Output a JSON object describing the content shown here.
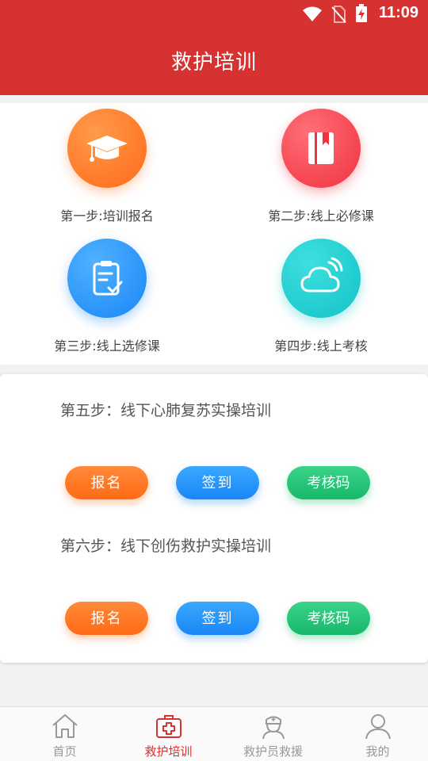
{
  "status_bar": {
    "time": "11:09"
  },
  "header": {
    "title": "救护培训"
  },
  "steps": [
    {
      "label": "第一步:培训报名",
      "icon": "graduation-cap-icon"
    },
    {
      "label": "第二步:线上必修课",
      "icon": "book-icon"
    },
    {
      "label": "第三步:线上选修课",
      "icon": "clipboard-check-icon"
    },
    {
      "label": "第四步:线上考核",
      "icon": "cloud-icon"
    }
  ],
  "offline": [
    {
      "title": "第五步：线下心肺复苏实操培训",
      "buttons": {
        "register": "报名",
        "checkin": "签到",
        "exam_code": "考核码"
      }
    },
    {
      "title": "第六步：线下创伤救护实操培训",
      "buttons": {
        "register": "报名",
        "checkin": "签到",
        "exam_code": "考核码"
      }
    }
  ],
  "nav": [
    {
      "label": "首页",
      "icon": "home-icon"
    },
    {
      "label": "救护培训",
      "icon": "medical-kit-icon",
      "active": true
    },
    {
      "label": "救护员救援",
      "icon": "nurse-icon"
    },
    {
      "label": "我的",
      "icon": "user-icon"
    }
  ],
  "colors": {
    "brand_red": "#d63232",
    "orange": "#ff6a1a",
    "red": "#f0323f",
    "blue": "#1a86f5",
    "teal": "#12c2c8",
    "green": "#17b86a"
  }
}
